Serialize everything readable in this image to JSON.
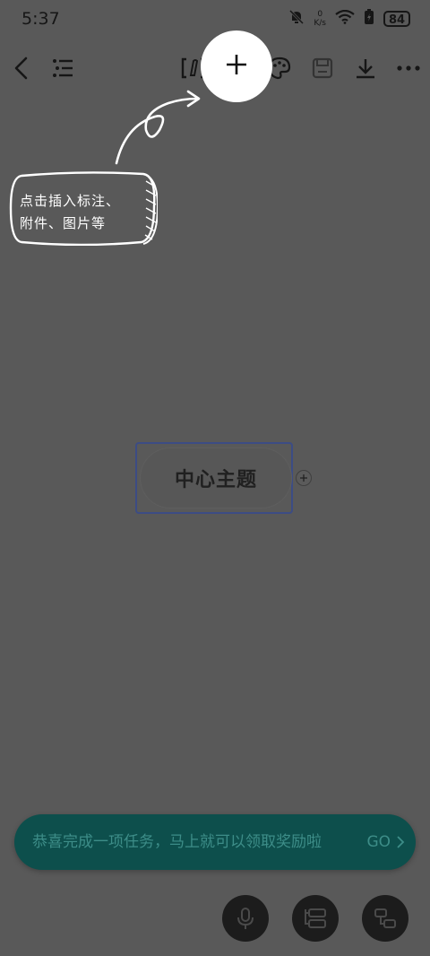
{
  "status_bar": {
    "time": "5:37",
    "net_speed_value": "0",
    "net_speed_unit": "K/s",
    "battery": "84"
  },
  "toolbar": {
    "icons": [
      "back-icon",
      "outline-icon",
      "annotation-icon",
      "plus-icon",
      "palette-icon",
      "save-icon",
      "download-icon",
      "more-icon"
    ]
  },
  "tip": {
    "text_line1": "点击插入标注、",
    "text_line2": "附件、图片等"
  },
  "canvas": {
    "central_topic": "中心主题"
  },
  "reward_banner": {
    "message": "恭喜完成一项任务，马上就可以领取奖励啦",
    "go_label": "GO"
  },
  "fabs": [
    "mic-icon",
    "layout-structure-icon",
    "add-node-icon"
  ],
  "colors": {
    "overlay": "#595959",
    "banner_bg": "#0d4f4c",
    "banner_text": "#3d8d88",
    "topic_border": "#3c4c84"
  }
}
